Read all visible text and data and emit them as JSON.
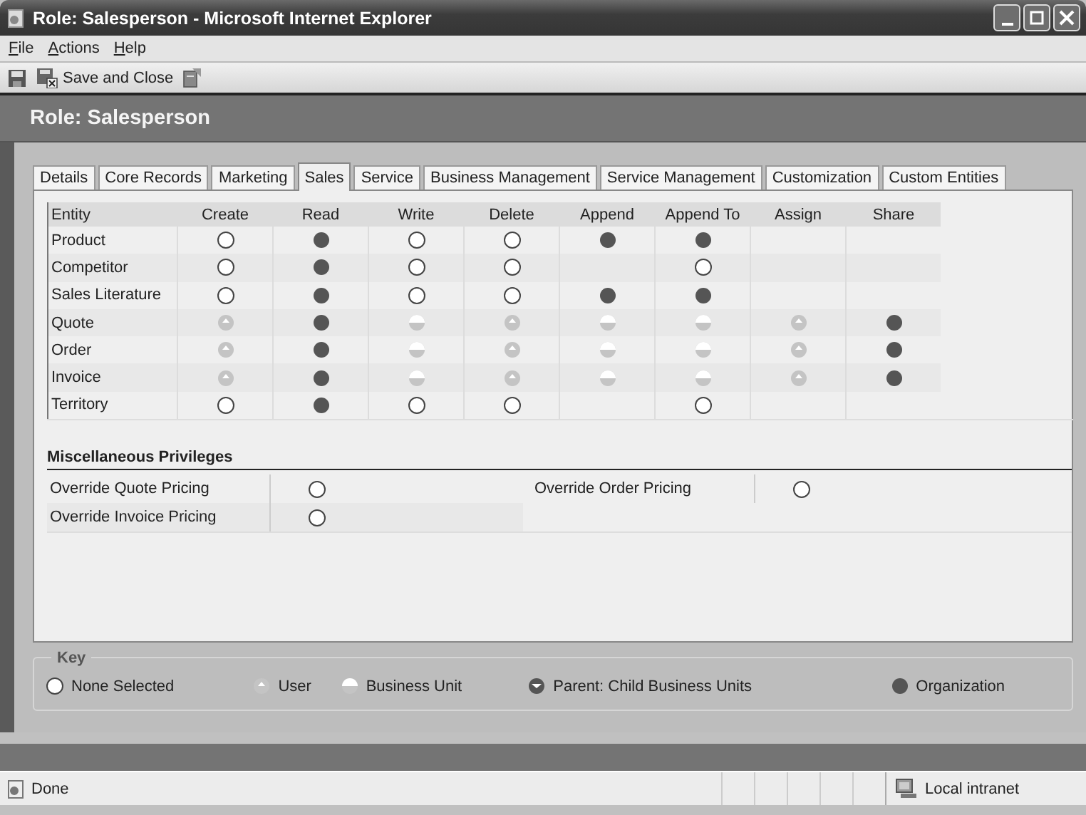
{
  "window": {
    "title": "Role: Salesperson - Microsoft Internet Explorer"
  },
  "menu": [
    {
      "label": "File"
    },
    {
      "label": "Actions"
    },
    {
      "label": "Help"
    }
  ],
  "toolbar": [
    {
      "kind": "save"
    },
    {
      "kind": "save_close",
      "label": "Save and Close"
    },
    {
      "kind": "assign"
    }
  ],
  "header": {
    "title": "Role: Salesperson"
  },
  "tabs": [
    {
      "label": "Details",
      "selected": false
    },
    {
      "label": "Core Records",
      "selected": false
    },
    {
      "label": "Marketing",
      "selected": false
    },
    {
      "label": "Sales",
      "selected": true
    },
    {
      "label": "Service",
      "selected": false
    },
    {
      "label": "Business Management",
      "selected": false
    },
    {
      "label": "Service Management",
      "selected": false
    },
    {
      "label": "Customization",
      "selected": false
    },
    {
      "label": "Custom Entities",
      "selected": false
    }
  ],
  "privileges": {
    "columns": [
      "Entity",
      "Create",
      "Read",
      "Write",
      "Delete",
      "Append",
      "Append To",
      "Assign",
      "Share"
    ],
    "rows": [
      {
        "entity": "Product",
        "cells": [
          {
            "kind": "none"
          },
          {
            "kind": "organization"
          },
          {
            "kind": "none"
          },
          {
            "kind": "none"
          },
          {
            "kind": "organization"
          },
          {
            "kind": "organization"
          },
          {
            "kind": "blank"
          },
          {
            "kind": "blank"
          }
        ]
      },
      {
        "entity": "Competitor",
        "cells": [
          {
            "kind": "none"
          },
          {
            "kind": "organization"
          },
          {
            "kind": "none"
          },
          {
            "kind": "none"
          },
          {
            "kind": "blank"
          },
          {
            "kind": "none"
          },
          {
            "kind": "blank"
          },
          {
            "kind": "blank"
          }
        ]
      },
      {
        "entity": "Sales Literature",
        "cells": [
          {
            "kind": "none"
          },
          {
            "kind": "organization"
          },
          {
            "kind": "none"
          },
          {
            "kind": "none"
          },
          {
            "kind": "organization"
          },
          {
            "kind": "organization"
          },
          {
            "kind": "blank"
          },
          {
            "kind": "blank"
          }
        ]
      },
      {
        "entity": "Quote",
        "cells": [
          {
            "kind": "user"
          },
          {
            "kind": "organization"
          },
          {
            "kind": "business_unit"
          },
          {
            "kind": "user"
          },
          {
            "kind": "business_unit"
          },
          {
            "kind": "business_unit"
          },
          {
            "kind": "user"
          },
          {
            "kind": "organization"
          }
        ]
      },
      {
        "entity": "Order",
        "cells": [
          {
            "kind": "user"
          },
          {
            "kind": "organization"
          },
          {
            "kind": "business_unit"
          },
          {
            "kind": "user"
          },
          {
            "kind": "business_unit"
          },
          {
            "kind": "business_unit"
          },
          {
            "kind": "user"
          },
          {
            "kind": "organization"
          }
        ]
      },
      {
        "entity": "Invoice",
        "cells": [
          {
            "kind": "user"
          },
          {
            "kind": "organization"
          },
          {
            "kind": "business_unit"
          },
          {
            "kind": "user"
          },
          {
            "kind": "business_unit"
          },
          {
            "kind": "business_unit"
          },
          {
            "kind": "user"
          },
          {
            "kind": "organization"
          }
        ]
      },
      {
        "entity": "Territory",
        "cells": [
          {
            "kind": "none"
          },
          {
            "kind": "organization"
          },
          {
            "kind": "none"
          },
          {
            "kind": "none"
          },
          {
            "kind": "blank"
          },
          {
            "kind": "none"
          },
          {
            "kind": "blank"
          },
          {
            "kind": "blank"
          }
        ]
      }
    ]
  },
  "misc": {
    "title": "Miscellaneous Privileges",
    "items": [
      {
        "label": "Override Quote Pricing",
        "kind": "none"
      },
      {
        "label": "Override Order Pricing",
        "kind": "none"
      },
      {
        "label": "Override Invoice Pricing",
        "kind": "none"
      }
    ]
  },
  "key": {
    "title": "Key",
    "items": [
      {
        "kind": "none",
        "label": "None Selected"
      },
      {
        "kind": "user",
        "label": "User"
      },
      {
        "kind": "business_unit",
        "label": "Business Unit"
      },
      {
        "kind": "parent",
        "label": "Parent: Child Business Units"
      },
      {
        "kind": "organization",
        "label": "Organization"
      }
    ]
  },
  "status_bar": {
    "text": "Done",
    "zone": "Local intranet"
  }
}
